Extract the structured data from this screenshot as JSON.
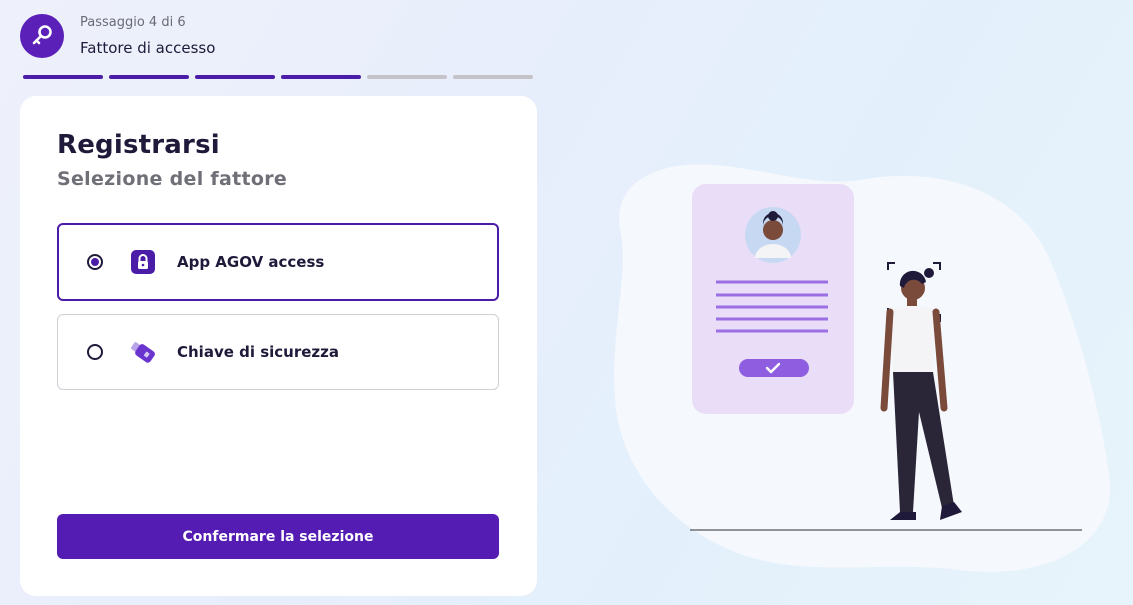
{
  "header": {
    "step_counter": "Passaggio 4 di 6",
    "step_title": "Fattore di accesso",
    "icon": "key-icon",
    "progress": {
      "completed": 4,
      "total": 6
    }
  },
  "card": {
    "title": "Registrarsi",
    "subtitle": "Selezione del fattore",
    "options": [
      {
        "label": "App AGOV access",
        "icon": "lock-app-icon",
        "selected": true
      },
      {
        "label": "Chiave di sicurezza",
        "icon": "usb-key-icon",
        "selected": false
      }
    ],
    "confirm_label": "Confermare la selezione"
  },
  "colors": {
    "primary": "#541cb3",
    "progress_done": "#4b1ca7",
    "progress_todo": "#c4c4c8",
    "text_dark": "#1f1a3a",
    "text_muted": "#6f6f78"
  }
}
